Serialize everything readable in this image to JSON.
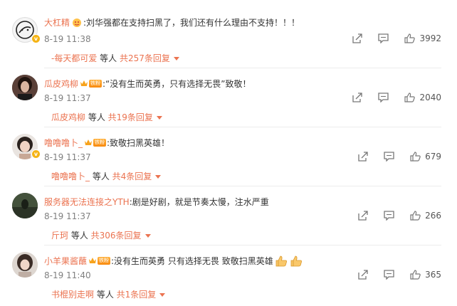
{
  "icons": {
    "share": "share-icon",
    "comment": "comment-icon",
    "like": "thumbs-up-icon"
  },
  "comments": [
    {
      "user": "大杠精",
      "badge": "emoji-icon",
      "text": ":刘华强都在支持扫黑了，我们还有什么理由不支持！！！",
      "time": "8-19 11:38",
      "reply_user": "-每天都可爱",
      "reply_suffix": " 等人 ",
      "reply_count": "共257条回复",
      "likes": "3992"
    },
    {
      "user": "瓜皮鸡柳",
      "badge": "铁粉",
      "text": ":“没有生而英勇，只有选择无畏”致敬！",
      "time": "8-19 11:37",
      "reply_user": "瓜皮鸡柳",
      "reply_suffix": " 等人 ",
      "reply_count": "共19条回复",
      "likes": "2040"
    },
    {
      "user": "噜噜噜卜_",
      "badge": "铁粉",
      "text": ":致敬扫黑英雄！",
      "time": "8-19 11:37",
      "reply_user": "噜噜噜卜_",
      "reply_suffix": " 等人 ",
      "reply_count": "共4条回复",
      "likes": "679"
    },
    {
      "user": "服务器无法连接之YTH",
      "badge": "",
      "text": ":剧是好剧，就是节奏太慢，注水严重",
      "time": "8-19 11:37",
      "reply_user": "斤珂",
      "reply_suffix": " 等人 ",
      "reply_count": "共306条回复",
      "likes": "266"
    },
    {
      "user": "小羊果酱蘸",
      "badge": "铁粉",
      "text": ":没有生而英勇 只有选择无畏 致敬扫黑英雄",
      "time": "8-19 11:40",
      "reply_user": "书棍别走啊",
      "reply_suffix": " 等人 ",
      "reply_count": "共1条回复",
      "likes": "365"
    }
  ]
}
